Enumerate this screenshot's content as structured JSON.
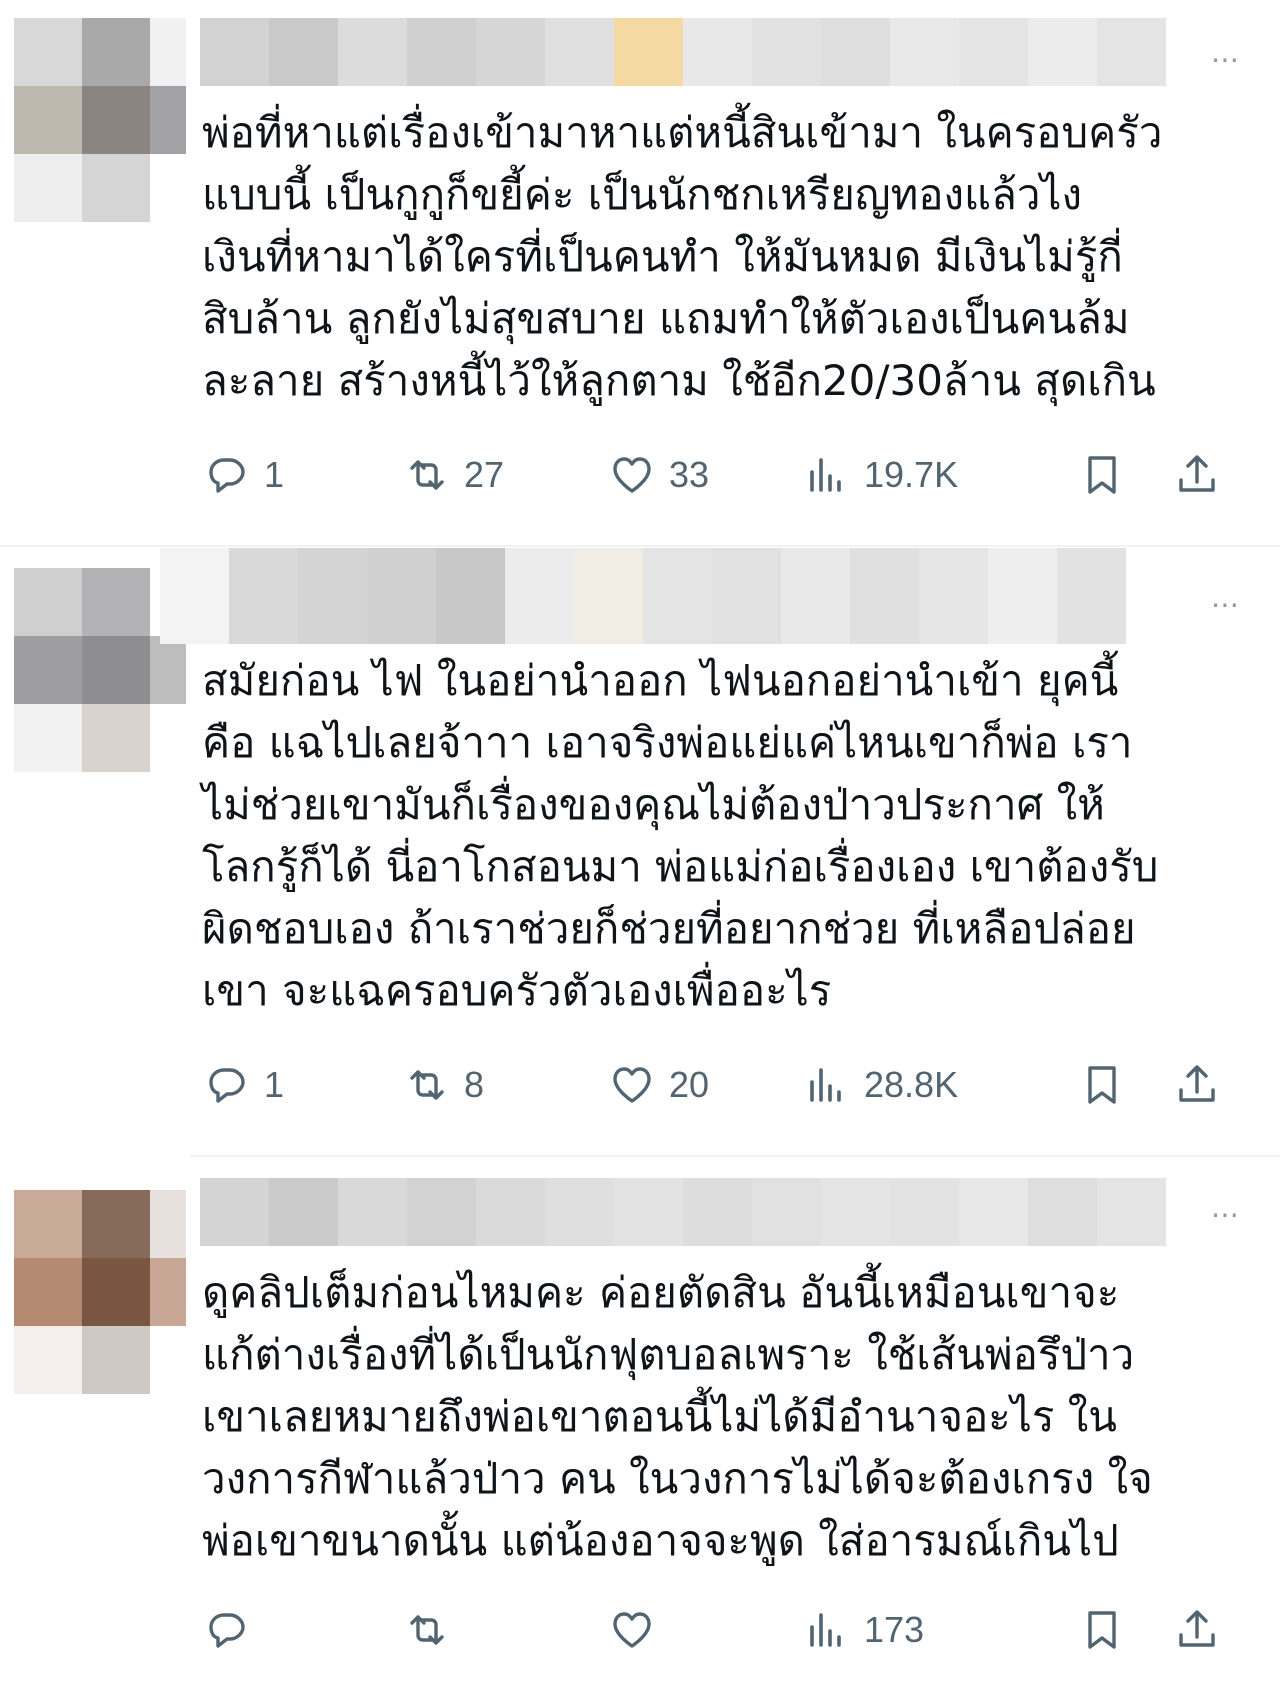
{
  "replies": [
    {
      "avatar_colors": [
        "#d8d8d8",
        "#a9a9a9",
        "#f1f1f1",
        "#bfb8ae",
        "#8b8480",
        "#a2a2a6",
        "#eeeeee",
        "#d5d5d5",
        "#ffffff"
      ],
      "name_colors": [
        "#d2d2d2",
        "#c9c9c9",
        "#dcdcdc",
        "#d0d0d0",
        "#d6d6d6",
        "#e0e0e0",
        "#f5d9a2",
        "#e8e8e8",
        "#e2e2e2",
        "#dedede",
        "#e9e9e9",
        "#e5e5e5",
        "#ececec",
        "#e4e4e4"
      ],
      "more_icon": "⋯",
      "lines": [
        "พ่อที่หาแต่เรื่องเข้ามาหาแต่หนี้สินเข้ามา ในครอบครัว",
        "แบบนี้ เป็นกูกูก็ขยี้ค่ะ เป็นนักชกเหรียญทองแล้วไง",
        "เงินที่หามาได้ใครที่เป็นคนทำ ให้มันหมด มีเงินไม่รู้กี่",
        "สิบล้าน ลูกยังไม่สุขสบาย แถมทำให้ตัวเองเป็นคนล้ม",
        "ละลาย สร้างหนี้ไว้ให้ลูกตาม ใช้อีก20/30ล้าน สุดเกิน"
      ],
      "stats": {
        "replies": "1",
        "reposts": "27",
        "likes": "33",
        "views": "19.7K"
      }
    },
    {
      "avatar_colors": [
        "#cfcfcf",
        "#b3b3b5",
        "#ffffff",
        "#9e9ea0",
        "#8e8e92",
        "#bdbdbd",
        "#f2f2f2",
        "#d8d3cc",
        "#ffffff"
      ],
      "name_colors": [
        "#f3f3f3",
        "#d9d9d9",
        "#d4d4d4",
        "#d0d0d0",
        "#c8c8c8",
        "#ececec",
        "#f2ede4",
        "#e4e4e4",
        "#e1e1e1",
        "#e9e9e9",
        "#e0e0e0",
        "#e6e6e6",
        "#eeeeee",
        "#e2e2e2"
      ],
      "more_icon": "⋯",
      "lines": [
        "สมัยก่อน ไฟ ในอย่านำออก ไฟนอกอย่านำเข้า ยุคนี้",
        "คือ แฉไปเลยจ้าาา เอาจริงพ่อแย่แค่ไหนเขาก็พ่อ เรา",
        "ไม่ช่วยเขามันก็เรื่องของคุณไม่ต้องป่าวประกาศ ให้",
        "โลกรู้ก็ได้ นี่อาโกสอนมา พ่อแม่ก่อเรื่องเอง เขาต้องรับ",
        "ผิดชอบเอง ถ้าเราช่วยก็ช่วยที่อยากช่วย ที่เหลือปล่อย",
        "เขา จะแฉครอบครัวตัวเองเพื่ออะไร"
      ],
      "stats": {
        "replies": "1",
        "reposts": "8",
        "likes": "20",
        "views": "28.8K"
      }
    },
    {
      "avatar_colors": [
        "#c9a998",
        "#866a5a",
        "#e8e0dc",
        "#b48a72",
        "#7a5540",
        "#c8a797",
        "#f4efec",
        "#d0c8c4",
        "#ffffff"
      ],
      "name_colors": [
        "#d4d4d4",
        "#cbcbcb",
        "#d9d9d9",
        "#d2d2d2",
        "#dadada",
        "#dfdfdf",
        "#e3e3e3",
        "#dddddd",
        "#e1e1e1",
        "#e5e5e5",
        "#e3e3e3",
        "#e8e8e8",
        "#dedede",
        "#e4e4e4"
      ],
      "more_icon": "⋯",
      "lines": [
        "ดูคลิปเต็มก่อนไหมคะ ค่อยตัดสิน อันนี้เหมือนเขาจะ",
        "แก้ต่างเรื่องที่ได้เป็นนักฟุตบอลเพราะ ใช้เส้นพ่อรึป่าว",
        "เขาเลยหมายถึงพ่อเขาตอนนี้ไม่ได้มีอำนาจอะไร ใน",
        "วงการกีฬาแล้วป่าว คน ในวงการไม่ได้จะต้องเกรง ใจ",
        "พ่อเขาขนาดนั้น แต่น้องอาจจะพูด ใส่อารมณ์เกินไป"
      ],
      "stats": {
        "replies": "",
        "reposts": "",
        "likes": "",
        "views": "173"
      }
    }
  ],
  "icons": {
    "reply": "reply-icon",
    "repost": "repost-icon",
    "like": "like-icon",
    "views": "views-icon",
    "bookmark": "bookmark-icon",
    "share": "share-icon"
  }
}
